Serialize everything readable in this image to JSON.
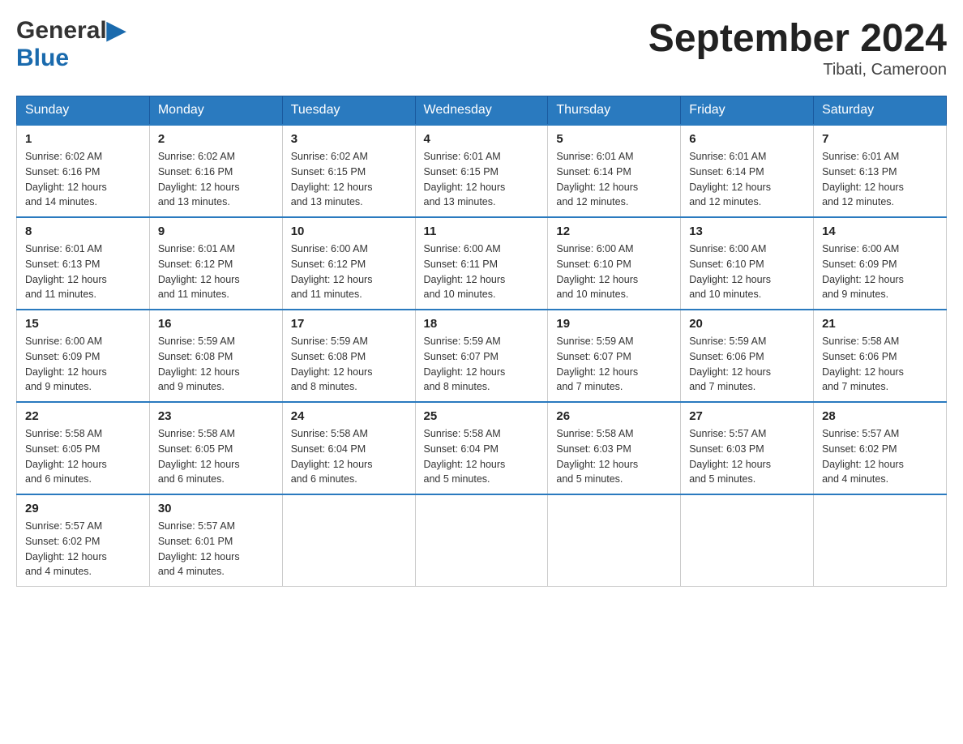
{
  "logo": {
    "general": "General",
    "blue": "Blue"
  },
  "title": "September 2024",
  "location": "Tibati, Cameroon",
  "days_of_week": [
    "Sunday",
    "Monday",
    "Tuesday",
    "Wednesday",
    "Thursday",
    "Friday",
    "Saturday"
  ],
  "weeks": [
    [
      {
        "day": "1",
        "sunrise": "6:02 AM",
        "sunset": "6:16 PM",
        "daylight": "12 hours and 14 minutes."
      },
      {
        "day": "2",
        "sunrise": "6:02 AM",
        "sunset": "6:16 PM",
        "daylight": "12 hours and 13 minutes."
      },
      {
        "day": "3",
        "sunrise": "6:02 AM",
        "sunset": "6:15 PM",
        "daylight": "12 hours and 13 minutes."
      },
      {
        "day": "4",
        "sunrise": "6:01 AM",
        "sunset": "6:15 PM",
        "daylight": "12 hours and 13 minutes."
      },
      {
        "day": "5",
        "sunrise": "6:01 AM",
        "sunset": "6:14 PM",
        "daylight": "12 hours and 12 minutes."
      },
      {
        "day": "6",
        "sunrise": "6:01 AM",
        "sunset": "6:14 PM",
        "daylight": "12 hours and 12 minutes."
      },
      {
        "day": "7",
        "sunrise": "6:01 AM",
        "sunset": "6:13 PM",
        "daylight": "12 hours and 12 minutes."
      }
    ],
    [
      {
        "day": "8",
        "sunrise": "6:01 AM",
        "sunset": "6:13 PM",
        "daylight": "12 hours and 11 minutes."
      },
      {
        "day": "9",
        "sunrise": "6:01 AM",
        "sunset": "6:12 PM",
        "daylight": "12 hours and 11 minutes."
      },
      {
        "day": "10",
        "sunrise": "6:00 AM",
        "sunset": "6:12 PM",
        "daylight": "12 hours and 11 minutes."
      },
      {
        "day": "11",
        "sunrise": "6:00 AM",
        "sunset": "6:11 PM",
        "daylight": "12 hours and 10 minutes."
      },
      {
        "day": "12",
        "sunrise": "6:00 AM",
        "sunset": "6:10 PM",
        "daylight": "12 hours and 10 minutes."
      },
      {
        "day": "13",
        "sunrise": "6:00 AM",
        "sunset": "6:10 PM",
        "daylight": "12 hours and 10 minutes."
      },
      {
        "day": "14",
        "sunrise": "6:00 AM",
        "sunset": "6:09 PM",
        "daylight": "12 hours and 9 minutes."
      }
    ],
    [
      {
        "day": "15",
        "sunrise": "6:00 AM",
        "sunset": "6:09 PM",
        "daylight": "12 hours and 9 minutes."
      },
      {
        "day": "16",
        "sunrise": "5:59 AM",
        "sunset": "6:08 PM",
        "daylight": "12 hours and 9 minutes."
      },
      {
        "day": "17",
        "sunrise": "5:59 AM",
        "sunset": "6:08 PM",
        "daylight": "12 hours and 8 minutes."
      },
      {
        "day": "18",
        "sunrise": "5:59 AM",
        "sunset": "6:07 PM",
        "daylight": "12 hours and 8 minutes."
      },
      {
        "day": "19",
        "sunrise": "5:59 AM",
        "sunset": "6:07 PM",
        "daylight": "12 hours and 7 minutes."
      },
      {
        "day": "20",
        "sunrise": "5:59 AM",
        "sunset": "6:06 PM",
        "daylight": "12 hours and 7 minutes."
      },
      {
        "day": "21",
        "sunrise": "5:58 AM",
        "sunset": "6:06 PM",
        "daylight": "12 hours and 7 minutes."
      }
    ],
    [
      {
        "day": "22",
        "sunrise": "5:58 AM",
        "sunset": "6:05 PM",
        "daylight": "12 hours and 6 minutes."
      },
      {
        "day": "23",
        "sunrise": "5:58 AM",
        "sunset": "6:05 PM",
        "daylight": "12 hours and 6 minutes."
      },
      {
        "day": "24",
        "sunrise": "5:58 AM",
        "sunset": "6:04 PM",
        "daylight": "12 hours and 6 minutes."
      },
      {
        "day": "25",
        "sunrise": "5:58 AM",
        "sunset": "6:04 PM",
        "daylight": "12 hours and 5 minutes."
      },
      {
        "day": "26",
        "sunrise": "5:58 AM",
        "sunset": "6:03 PM",
        "daylight": "12 hours and 5 minutes."
      },
      {
        "day": "27",
        "sunrise": "5:57 AM",
        "sunset": "6:03 PM",
        "daylight": "12 hours and 5 minutes."
      },
      {
        "day": "28",
        "sunrise": "5:57 AM",
        "sunset": "6:02 PM",
        "daylight": "12 hours and 4 minutes."
      }
    ],
    [
      {
        "day": "29",
        "sunrise": "5:57 AM",
        "sunset": "6:02 PM",
        "daylight": "12 hours and 4 minutes."
      },
      {
        "day": "30",
        "sunrise": "5:57 AM",
        "sunset": "6:01 PM",
        "daylight": "12 hours and 4 minutes."
      },
      null,
      null,
      null,
      null,
      null
    ]
  ]
}
